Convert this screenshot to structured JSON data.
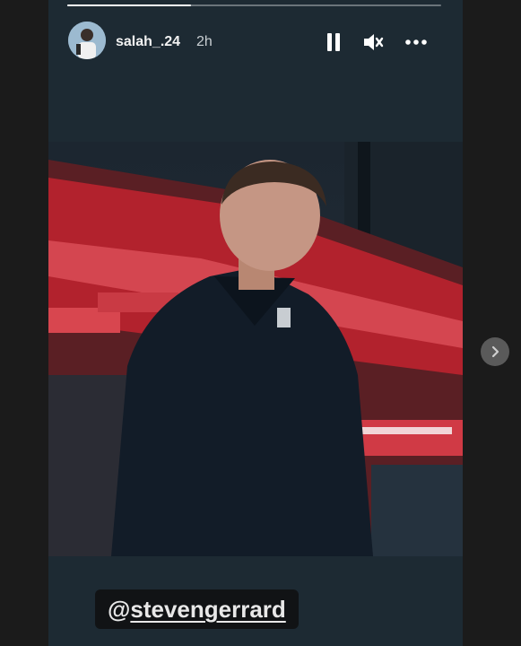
{
  "story": {
    "progress_fraction": 0.33,
    "user": {
      "username": "salah_.24",
      "timestamp": "2h",
      "avatar_icon": "avatar-photo-icon"
    },
    "controls": {
      "pause_icon": "pause-icon",
      "mute_icon": "muted-speaker-icon",
      "more_icon": "more-options-icon"
    },
    "mention": {
      "at": "@",
      "handle": "stevengerrard"
    }
  },
  "navigation": {
    "next_icon": "chevron-right-icon"
  },
  "colors": {
    "page_bg": "#1b1b1b",
    "story_bg": "#1d2a33",
    "crowd_red": "#c7212b",
    "text": "#f3f3f3"
  }
}
